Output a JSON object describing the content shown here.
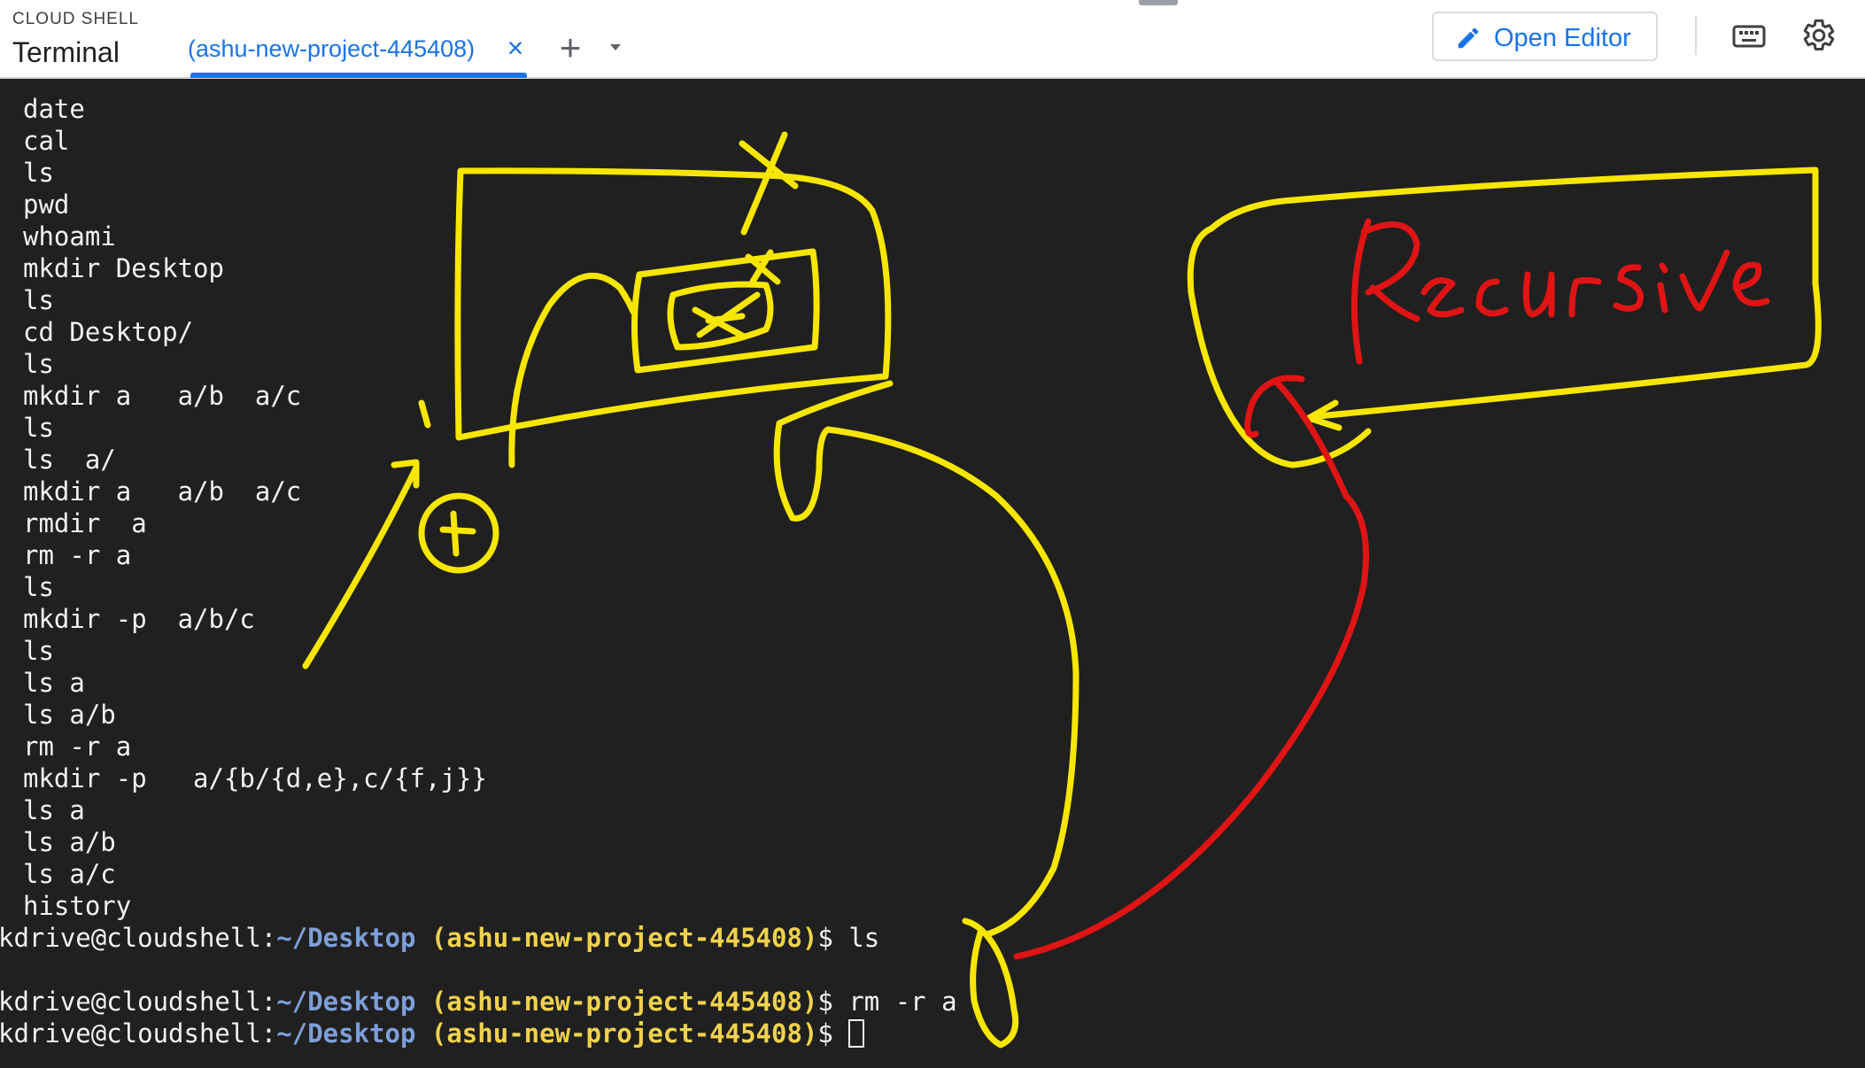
{
  "header": {
    "app_label": "CLOUD SHELL",
    "app_title": "Terminal",
    "tab_label": "(ashu-new-project-445408)",
    "tab_close_icon": "close-icon",
    "new_tab_icon": "plus-icon",
    "tab_menu_icon": "caret-down-icon",
    "open_editor_label": "Open Editor",
    "open_editor_icon": "pencil-icon",
    "keyboard_icon": "keyboard-icon",
    "settings_icon": "gear-icon"
  },
  "colors": {
    "accent": "#1a73e8",
    "terminal_bg": "#202020",
    "prompt_path": "#7e9fd8",
    "prompt_project": "#f0d24d",
    "annotation_yellow": "#f7e600",
    "annotation_red": "#e01414"
  },
  "terminal": {
    "history": [
      "date",
      "cal",
      "ls",
      "pwd",
      "whoami",
      "mkdir Desktop",
      "ls",
      "cd Desktop/",
      "ls",
      "mkdir a   a/b  a/c",
      "ls",
      "ls  a/",
      "mkdir a   a/b  a/c",
      "rmdir  a",
      "rm -r a",
      "ls",
      "mkdir -p  a/b/c",
      "ls",
      "ls a",
      "ls a/b",
      "rm -r a",
      "mkdir -p   a/{b/{d,e},c/{f,j}}",
      "ls a",
      "ls a/b",
      "ls a/c",
      "history"
    ],
    "prompts": [
      {
        "user": "kdrive@cloudshell:",
        "path": "~/Desktop",
        "project": "(ashu-new-project-445408)",
        "dollar": "$ ",
        "command": "ls"
      },
      {
        "user": "kdrive@cloudshell:",
        "path": "~/Desktop",
        "project": "(ashu-new-project-445408)",
        "dollar": "$ ",
        "command": "rm -r a"
      },
      {
        "user": "kdrive@cloudshell:",
        "path": "~/Desktop",
        "project": "(ashu-new-project-445408)",
        "dollar": "$ ",
        "command": ""
      }
    ]
  },
  "annotations": {
    "handwritten_label": "Recursive"
  }
}
